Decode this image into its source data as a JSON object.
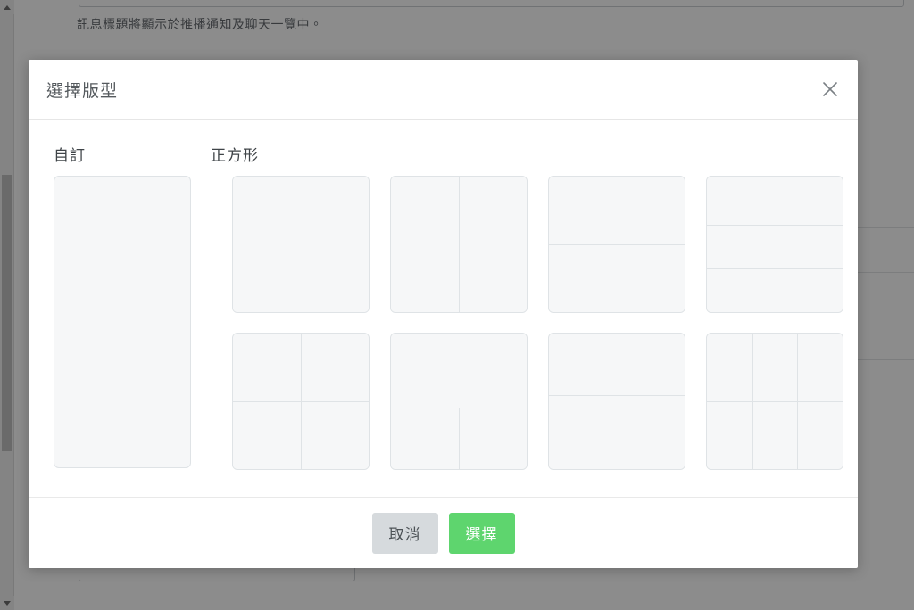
{
  "background": {
    "helper_text": "訊息標題將顯示於推播通知及聊天一覽中。",
    "dividers_y": [
      255,
      305,
      355,
      403
    ]
  },
  "scrollbar": {
    "up_arrow_icon": "triangle-up-icon",
    "down_arrow_icon": "triangle-down-icon",
    "thumb_label": "scroll-thumb"
  },
  "modal": {
    "title": "選擇版型",
    "close_icon": "close-icon",
    "sections": {
      "custom_label": "自訂",
      "square_label": "正方形"
    },
    "custom_template": {
      "name": "custom-blank",
      "layout": "single-tall"
    },
    "square_templates": [
      {
        "name": "square-1-full",
        "layout": "lay-1",
        "cells": 1
      },
      {
        "name": "square-2-columns",
        "layout": "lay-2cols",
        "cells": 2
      },
      {
        "name": "square-2-rows",
        "layout": "lay-2rows",
        "cells": 2
      },
      {
        "name": "square-3-rows",
        "layout": "lay-3rows",
        "cells": 3
      },
      {
        "name": "square-2x2-grid",
        "layout": "lay-2x2",
        "cells": 4
      },
      {
        "name": "square-top-plus-2",
        "layout": "lay-top-2",
        "cells": 3
      },
      {
        "name": "square-big-plus-2thin",
        "layout": "lay-big-2thin",
        "cells": 3
      },
      {
        "name": "square-3x2-grid",
        "layout": "lay-3x2",
        "cells": 6
      }
    ],
    "footer": {
      "cancel_label": "取消",
      "confirm_label": "選擇"
    }
  },
  "colors": {
    "confirm_green": "#5ed56e",
    "cancel_gray": "#d6dadd",
    "template_fill": "#f6f7f8",
    "template_border": "#dfe3e6",
    "overlay": "rgba(0,0,0,0.45)",
    "title_text": "#555a5e"
  }
}
